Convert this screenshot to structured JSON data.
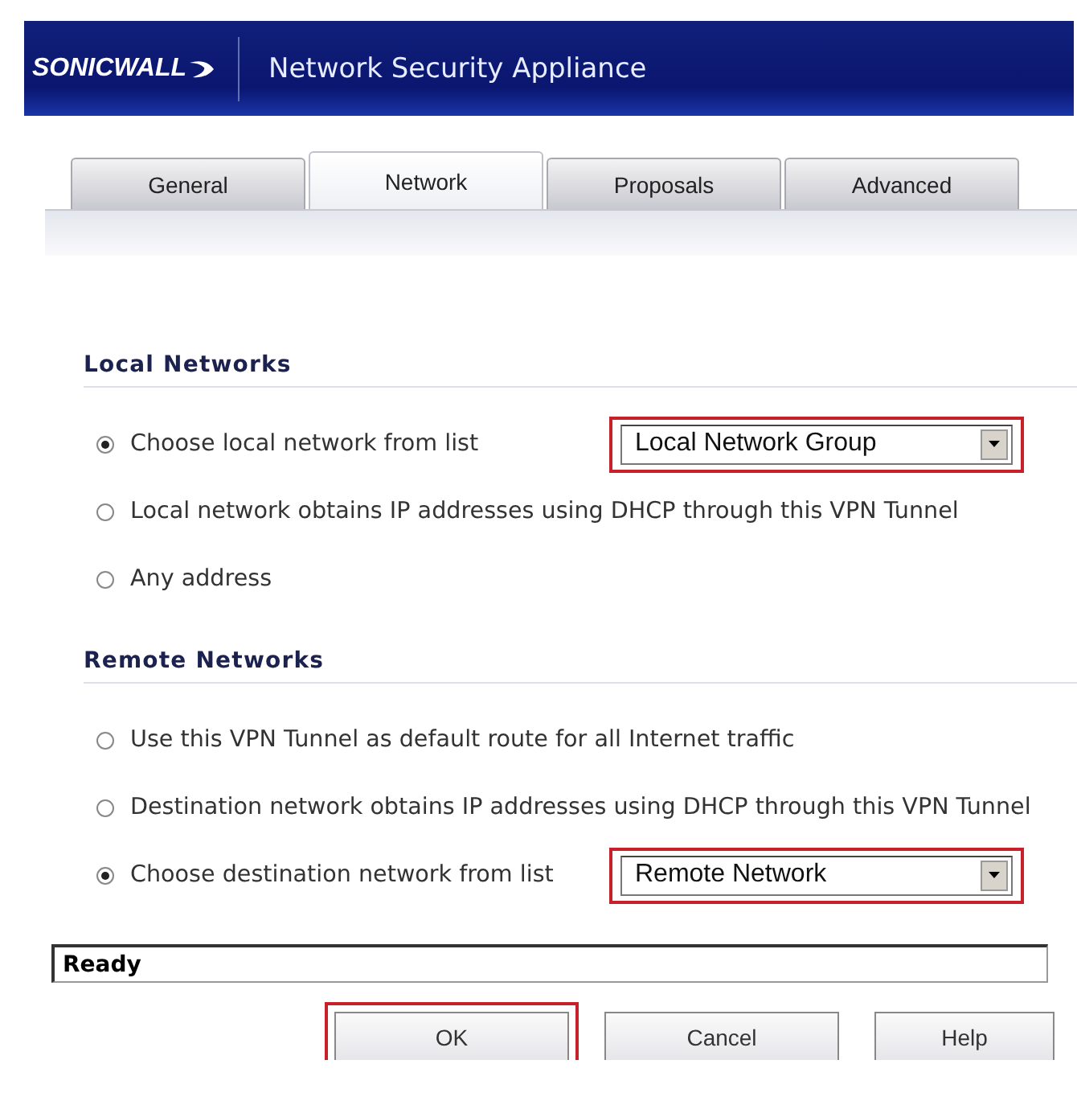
{
  "header": {
    "logo": "SONICWALL",
    "title": "Network Security Appliance"
  },
  "tabs": [
    {
      "label": "General",
      "selected": false
    },
    {
      "label": "Network",
      "selected": true
    },
    {
      "label": "Proposals",
      "selected": false
    },
    {
      "label": "Advanced",
      "selected": false
    }
  ],
  "sections": [
    {
      "title": "Local Networks",
      "options": [
        {
          "label": "Choose local network from list",
          "selected": true,
          "select": {
            "value": "Local Network Group",
            "highlighted": true
          }
        },
        {
          "label": "Local network obtains IP addresses using DHCP through this VPN Tunnel",
          "selected": false
        },
        {
          "label": "Any address",
          "selected": false
        }
      ]
    },
    {
      "title": "Remote Networks",
      "options": [
        {
          "label": "Use this VPN Tunnel as default route for all Internet traffic",
          "selected": false
        },
        {
          "label": "Destination network obtains IP addresses using DHCP through this VPN Tunnel",
          "selected": false
        },
        {
          "label": "Choose destination network from list",
          "selected": true,
          "select": {
            "value": "Remote Network",
            "highlighted": true
          }
        }
      ]
    }
  ],
  "status_bar": "Ready",
  "buttons": [
    {
      "label": "OK",
      "highlighted": true
    },
    {
      "label": "Cancel",
      "highlighted": false
    },
    {
      "label": "Help",
      "highlighted": false
    }
  ]
}
